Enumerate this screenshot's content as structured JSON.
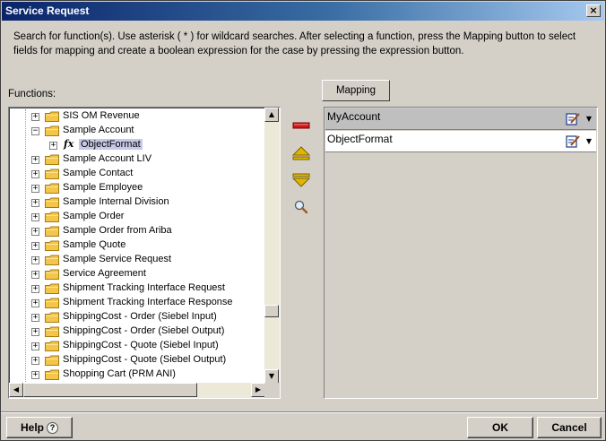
{
  "window": {
    "title": "Service Request",
    "close_glyph": "×"
  },
  "instructions": "Search for function(s). Use asterisk ( * ) for wildcard searches. After selecting a function, press the Mapping button to select fields for mapping and create a boolean expression for the case by pressing the expression button.",
  "functions_label": "Functions:",
  "tree": {
    "items": [
      {
        "label": "SIS OM Revenue",
        "expander": "+",
        "level": 0
      },
      {
        "label": "Sample Account",
        "expander": "−",
        "level": 0
      },
      {
        "label": "ObjectFormat",
        "expander": "+",
        "level": 1,
        "type": "function",
        "selected": true
      },
      {
        "label": "Sample Account LIV",
        "expander": "+",
        "level": 0
      },
      {
        "label": "Sample Contact",
        "expander": "+",
        "level": 0
      },
      {
        "label": "Sample Employee",
        "expander": "+",
        "level": 0
      },
      {
        "label": "Sample Internal Division",
        "expander": "+",
        "level": 0
      },
      {
        "label": "Sample Order",
        "expander": "+",
        "level": 0
      },
      {
        "label": "Sample Order from Ariba",
        "expander": "+",
        "level": 0
      },
      {
        "label": "Sample Quote",
        "expander": "+",
        "level": 0
      },
      {
        "label": "Sample Service Request",
        "expander": "+",
        "level": 0
      },
      {
        "label": "Service Agreement",
        "expander": "+",
        "level": 0
      },
      {
        "label": "Shipment Tracking Interface Request",
        "expander": "+",
        "level": 0
      },
      {
        "label": "Shipment Tracking Interface Response",
        "expander": "+",
        "level": 0
      },
      {
        "label": "ShippingCost - Order (Siebel Input)",
        "expander": "+",
        "level": 0
      },
      {
        "label": "ShippingCost - Order (Siebel Output)",
        "expander": "+",
        "level": 0
      },
      {
        "label": "ShippingCost - Quote (Siebel Input)",
        "expander": "+",
        "level": 0
      },
      {
        "label": "ShippingCost - Quote (Siebel Output)",
        "expander": "+",
        "level": 0
      },
      {
        "label": "Shopping Cart (PRM ANI)",
        "expander": "+",
        "level": 0
      }
    ],
    "fx_glyph": "fx",
    "scroll_up": "▲",
    "scroll_down": "▼",
    "scroll_left": "◀",
    "scroll_right": "▶",
    "vscroll_level": 0.78,
    "hscroll_level": 0.0
  },
  "tools": {
    "remove": "remove-icon",
    "move_up": "arrow-up-icon",
    "move_down": "arrow-down-icon",
    "search": "magnifier-icon"
  },
  "mapping": {
    "button_label": "Mapping",
    "rows": [
      {
        "name": "MyAccount",
        "selected": true
      },
      {
        "name": "ObjectFormat",
        "selected": false
      }
    ],
    "dropdown_glyph": "▼"
  },
  "footer": {
    "help_label": "Help",
    "help_glyph": "?",
    "ok_label": "OK",
    "cancel_label": "Cancel"
  },
  "colors": {
    "titlebar_start": "#0a246a",
    "titlebar_end": "#a6caf0",
    "selection": "#c7c7e7",
    "folder": "#f3c64a"
  }
}
